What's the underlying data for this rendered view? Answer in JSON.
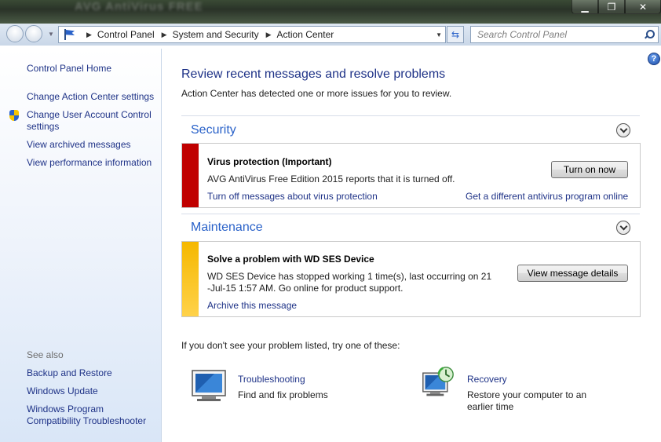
{
  "window": {
    "minimize_glyph": "▁",
    "restore_glyph": "❐",
    "close_glyph": "✕",
    "background_title": "AVG AntiVirus FREE"
  },
  "address_bar": {
    "breadcrumbs": [
      "Control Panel",
      "System and Security",
      "Action Center"
    ],
    "search_placeholder": "Search Control Panel"
  },
  "sidebar": {
    "home": "Control Panel Home",
    "links": [
      "Change Action Center settings",
      "Change User Account Control settings",
      "View archived messages",
      "View performance information"
    ],
    "see_also_label": "See also",
    "see_also": [
      "Backup and Restore",
      "Windows Update",
      "Windows Program Compatibility Troubleshooter"
    ]
  },
  "main": {
    "title": "Review recent messages and resolve problems",
    "subtitle": "Action Center has detected one or more issues for you to review.",
    "help_glyph": "?",
    "security": {
      "heading": "Security",
      "item_title": "Virus protection  (Important)",
      "item_text": "AVG AntiVirus Free Edition 2015 reports that it is turned off.",
      "turn_off_link": "Turn off messages about virus protection",
      "alt_link": "Get a different antivirus program online",
      "button": "Turn on now",
      "stripe_color": "#c00000"
    },
    "maintenance": {
      "heading": "Maintenance",
      "item_title": "Solve a problem with WD SES Device",
      "item_text_1": "WD SES Device has stopped working  1 time(s), last occurring on 21",
      "item_text_2": "-Jul-15 1:57 AM.  Go online for product support.",
      "archive_link": "Archive this message",
      "button": "View message details",
      "stripe_color": "#f5b800"
    },
    "try_text": "If you don't see your problem listed, try one of these:",
    "tools": [
      {
        "label": "Troubleshooting",
        "desc": "Find and fix problems",
        "icon": "troubleshooting-icon"
      },
      {
        "label": "Recovery",
        "desc_1": "Restore your computer to an",
        "desc_2": "earlier time",
        "icon": "recovery-icon"
      }
    ]
  },
  "colors": {
    "link": "#1e3287",
    "section_heading": "#2a62c9",
    "sidebar_bottom": "#d9e6f7"
  }
}
